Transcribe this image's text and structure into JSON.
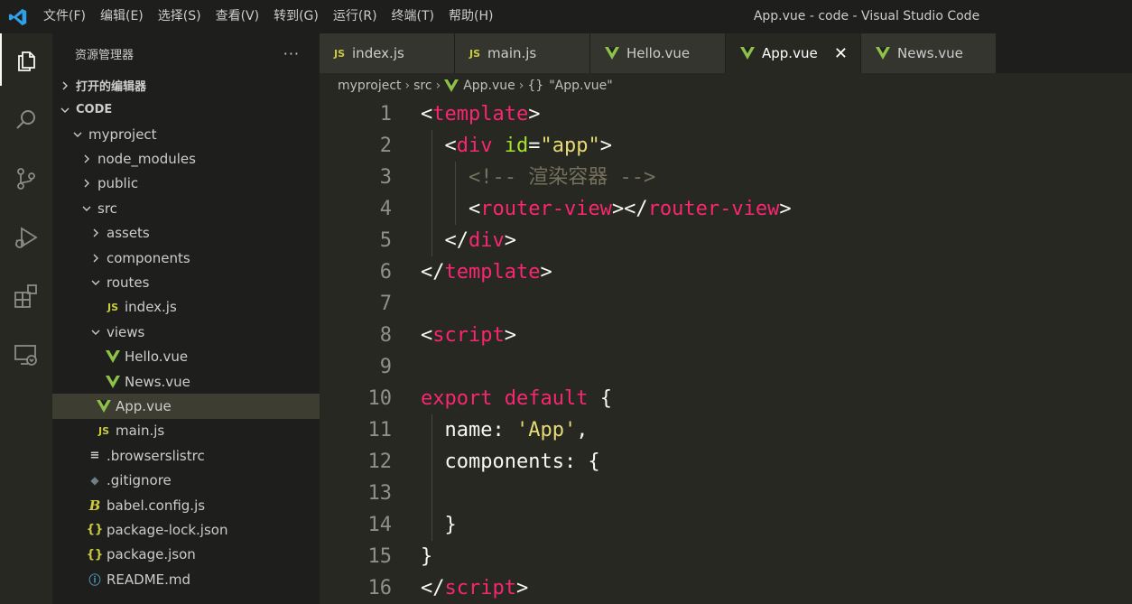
{
  "titlebar": {
    "menu": [
      "文件(F)",
      "编辑(E)",
      "选择(S)",
      "查看(V)",
      "转到(G)",
      "运行(R)",
      "终端(T)",
      "帮助(H)"
    ],
    "window_title": "App.vue - code - Visual Studio Code"
  },
  "activity_bar": [
    "explorer-icon",
    "search-icon",
    "source-control-icon",
    "run-debug-icon",
    "extensions-icon",
    "remote-explorer-icon"
  ],
  "sidebar": {
    "title": "资源管理器",
    "more": "···",
    "open_editors": "打开的编辑器",
    "workspace": "CODE",
    "tree": [
      {
        "label": "myproject",
        "type": "folder-open",
        "depth": 0
      },
      {
        "label": "node_modules",
        "type": "folder",
        "depth": 1
      },
      {
        "label": "public",
        "type": "folder",
        "depth": 1
      },
      {
        "label": "src",
        "type": "folder-open",
        "depth": 1
      },
      {
        "label": "assets",
        "type": "folder",
        "depth": 2
      },
      {
        "label": "components",
        "type": "folder",
        "depth": 2
      },
      {
        "label": "routes",
        "type": "folder-open",
        "depth": 2
      },
      {
        "label": "index.js",
        "type": "js",
        "depth": 3
      },
      {
        "label": "views",
        "type": "folder-open",
        "depth": 2
      },
      {
        "label": "Hello.vue",
        "type": "vue",
        "depth": 3
      },
      {
        "label": "News.vue",
        "type": "vue",
        "depth": 3
      },
      {
        "label": "App.vue",
        "type": "vue",
        "depth": 2,
        "selected": true
      },
      {
        "label": "main.js",
        "type": "js",
        "depth": 2
      },
      {
        "label": ".browserslistrc",
        "type": "lines",
        "depth": 1
      },
      {
        "label": ".gitignore",
        "type": "git",
        "depth": 1
      },
      {
        "label": "babel.config.js",
        "type": "babel",
        "depth": 1
      },
      {
        "label": "package-lock.json",
        "type": "json",
        "depth": 1
      },
      {
        "label": "package.json",
        "type": "json",
        "depth": 1
      },
      {
        "label": "README.md",
        "type": "info",
        "depth": 1
      }
    ]
  },
  "tabs": [
    {
      "label": "index.js",
      "type": "js"
    },
    {
      "label": "main.js",
      "type": "js"
    },
    {
      "label": "Hello.vue",
      "type": "vue"
    },
    {
      "label": "App.vue",
      "type": "vue",
      "active": true
    },
    {
      "label": "News.vue",
      "type": "vue"
    }
  ],
  "breadcrumb": [
    "myproject",
    "src",
    "App.vue",
    "\"App.vue\""
  ],
  "editor": {
    "lines": [
      [
        [
          "tag-bracket",
          "<"
        ],
        [
          "tag",
          "template"
        ],
        [
          "tag-bracket",
          ">"
        ]
      ],
      [
        [
          "plain",
          "  "
        ],
        [
          "tag-bracket",
          "<"
        ],
        [
          "tag",
          "div"
        ],
        [
          "plain",
          " "
        ],
        [
          "attr",
          "id"
        ],
        [
          "plain",
          "="
        ],
        [
          "str",
          "\"app\""
        ],
        [
          "tag-bracket",
          ">"
        ]
      ],
      [
        [
          "plain",
          "    "
        ],
        [
          "cmt",
          "<!-- 渲染容器 -->"
        ]
      ],
      [
        [
          "plain",
          "    "
        ],
        [
          "tag-bracket",
          "<"
        ],
        [
          "tag",
          "router-view"
        ],
        [
          "tag-bracket",
          "></"
        ],
        [
          "tag",
          "router-view"
        ],
        [
          "tag-bracket",
          ">"
        ]
      ],
      [
        [
          "plain",
          "  "
        ],
        [
          "tag-bracket",
          "</"
        ],
        [
          "tag",
          "div"
        ],
        [
          "tag-bracket",
          ">"
        ]
      ],
      [
        [
          "tag-bracket",
          "</"
        ],
        [
          "tag",
          "template"
        ],
        [
          "tag-bracket",
          ">"
        ]
      ],
      [],
      [
        [
          "tag-bracket",
          "<"
        ],
        [
          "tag",
          "script"
        ],
        [
          "tag-bracket",
          ">"
        ]
      ],
      [],
      [
        [
          "kw",
          "export"
        ],
        [
          "plain",
          " "
        ],
        [
          "kw",
          "default"
        ],
        [
          "plain",
          " {"
        ]
      ],
      [
        [
          "plain",
          "  name: "
        ],
        [
          "str",
          "'App'"
        ],
        [
          "plain",
          ","
        ]
      ],
      [
        [
          "plain",
          "  components: {"
        ]
      ],
      [],
      [
        [
          "plain",
          "  }"
        ]
      ],
      [
        [
          "plain",
          "}"
        ]
      ],
      [
        [
          "tag-bracket",
          "</"
        ],
        [
          "tag",
          "script"
        ],
        [
          "tag-bracket",
          ">"
        ]
      ]
    ]
  },
  "colors": {
    "editor_bg": "#272822",
    "sidebar_bg": "#1e1f1c",
    "tag": "#f92672",
    "attr": "#a6e22e",
    "string": "#e6db74",
    "comment": "#75715e",
    "vue_icon": "#8dc149",
    "js_icon": "#cbcb41"
  }
}
